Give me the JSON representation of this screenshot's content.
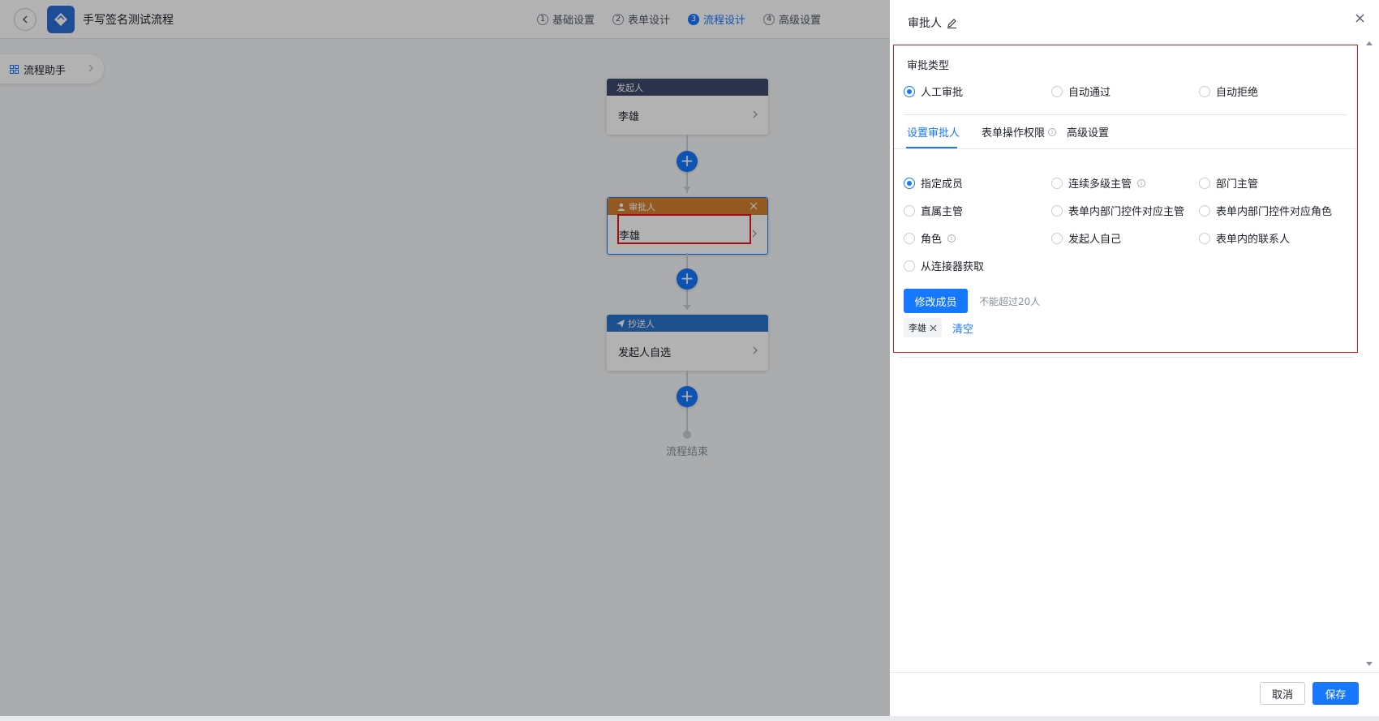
{
  "header": {
    "app_title": "手写签名测试流程",
    "steps": [
      {
        "num": "1",
        "label": "基础设置"
      },
      {
        "num": "2",
        "label": "表单设计"
      },
      {
        "num": "3",
        "label": "流程设计"
      },
      {
        "num": "4",
        "label": "高级设置"
      }
    ]
  },
  "assistant": {
    "label": "流程助手"
  },
  "flow": {
    "initiator": {
      "head": "发起人",
      "body": "李雄"
    },
    "approver": {
      "head": "审批人",
      "body": "李雄"
    },
    "cc": {
      "head": "抄送人",
      "body": "发起人自选"
    },
    "end_label": "流程结束"
  },
  "drawer": {
    "title": "审批人",
    "approval_type_label": "审批类型",
    "approval_types": [
      "人工审批",
      "自动通过",
      "自动拒绝"
    ],
    "tabs": [
      "设置审批人",
      "表单操作权限",
      "高级设置"
    ],
    "approver_options": [
      "指定成员",
      "连续多级主管",
      "部门主管",
      "直属主管",
      "表单内部门控件对应主管",
      "表单内部门控件对应角色",
      "角色",
      "发起人自己",
      "表单内的联系人",
      "从连接器获取"
    ],
    "modify_button": "修改成员",
    "limit_hint": "不能超过20人",
    "selected_member": "李雄",
    "clear_link": "清空",
    "cancel_button": "取消",
    "save_button": "保存"
  },
  "colors": {
    "accent": "#1677ff",
    "initiator_head": "#3d4a6b",
    "approver_head": "#d3802f",
    "cc_head": "#2a73c9",
    "highlight": "#e6141b"
  }
}
